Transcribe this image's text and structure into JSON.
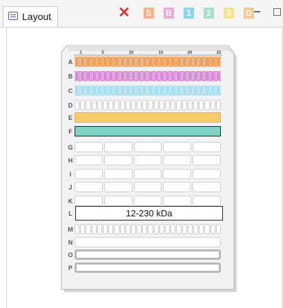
{
  "tab": {
    "title": "Layout"
  },
  "toolbar": {
    "delete_icon": "✕",
    "chips": [
      {
        "label": "S",
        "color": "#f6b08a"
      },
      {
        "label": "B",
        "color": "#f0a8d6"
      },
      {
        "label": "1",
        "color": "#8fd3ee"
      },
      {
        "label": "2",
        "color": "#a4e2c8"
      },
      {
        "label": "3",
        "color": "#f6e48d"
      },
      {
        "label": "D",
        "color": "#f7c98b"
      }
    ]
  },
  "gel": {
    "ruler": [
      "1",
      "5",
      "10",
      "15",
      "20",
      "25"
    ],
    "rows": [
      {
        "label": "A",
        "style": "wells",
        "color": "#f0a05a"
      },
      {
        "label": "B",
        "style": "wells",
        "color": "#d88ed6"
      },
      {
        "label": "C",
        "style": "wells",
        "color": "#a9dfee"
      },
      {
        "label": "D",
        "style": "wells",
        "color": ""
      },
      {
        "label": "E",
        "style": "solid",
        "color": "#f6cc6a"
      },
      {
        "label": "F",
        "style": "selected",
        "color": "#7fd2c6"
      },
      {
        "label": "G",
        "style": "split",
        "color": ""
      },
      {
        "label": "H",
        "style": "split",
        "color": ""
      },
      {
        "label": "I",
        "style": "split",
        "color": ""
      },
      {
        "label": "J",
        "style": "split",
        "color": ""
      },
      {
        "label": "K",
        "style": "split",
        "color": ""
      },
      {
        "label": "L",
        "style": "marker",
        "color": "",
        "text": "12-230 kDa"
      },
      {
        "label": "M",
        "style": "wells",
        "color": ""
      },
      {
        "label": "N",
        "style": "empty",
        "color": ""
      },
      {
        "label": "O",
        "style": "thick",
        "color": ""
      },
      {
        "label": "P",
        "style": "thick",
        "color": ""
      }
    ]
  }
}
